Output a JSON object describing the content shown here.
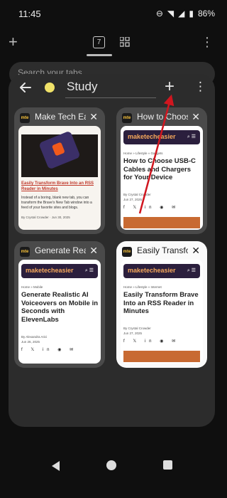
{
  "status": {
    "time": "11:45",
    "battery": "86%"
  },
  "topbar": {
    "tab_count": "7",
    "search_placeholder": "Search your tabs"
  },
  "group": {
    "title": "Study",
    "dot_color": "#f0e269"
  },
  "tabs": [
    {
      "title": "Make Tech Easier",
      "favicon": "mte",
      "kind": "listing",
      "link": "Easily Transform Brave Into an RSS Reader in Minutes",
      "body": "Instead of a boring, blank new tab, you can transform the Brave's New Tab window into a feed of your favorite sites and blogs.",
      "meta": "By Crystal Crowder · Jun 30, 2025"
    },
    {
      "title": "How to Choose USB-C Cables",
      "favicon": "mte",
      "kind": "article",
      "brand": "maketecheasier",
      "crumb": "Home » Lifestyle » Gadgets",
      "headline": "How to Choose USB-C Cables and Chargers for Your Device",
      "author": "By Crystal Crowder",
      "date": "Jun 27, 2025"
    },
    {
      "title": "Generate Realistic AI",
      "favicon": "mte",
      "kind": "article",
      "brand": "maketecheasier",
      "crumb": "Home » Mobile",
      "headline": "Generate Realistic AI Voiceovers on Mobile in Seconds with ElevenLabs",
      "author": "By Alexandra Arici",
      "date": "Jun 26, 2025"
    },
    {
      "title": "Easily Transform Brave",
      "favicon": "mte",
      "kind": "article",
      "brand": "maketecheasier",
      "crumb": "Home » Lifestyle » Internet",
      "headline": "Easily Transform Brave Into an RSS Reader in Minutes",
      "author": "By Crystal Crowder",
      "date": "Jun 27, 2025"
    }
  ]
}
